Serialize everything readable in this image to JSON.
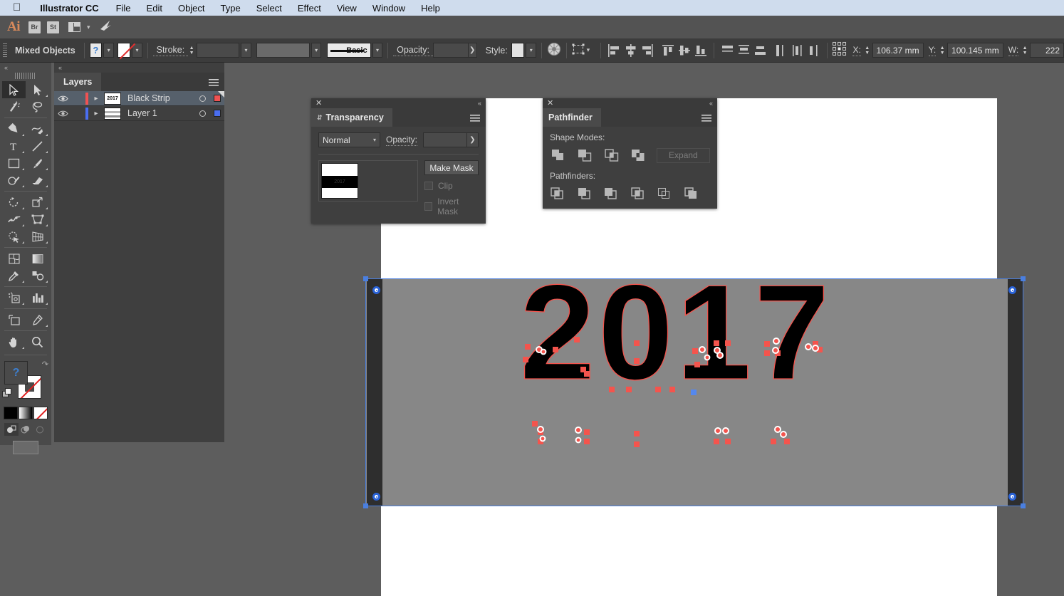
{
  "menubar": {
    "apple_glyph": "",
    "app_name": "Illustrator CC",
    "items": [
      "File",
      "Edit",
      "Object",
      "Type",
      "Select",
      "Effect",
      "View",
      "Window",
      "Help"
    ]
  },
  "appbar": {
    "logo": "Ai",
    "bridge_label": "Br",
    "stock_label": "St",
    "workspace_icon": "arrange-documents-icon",
    "behance_icon": "behance-icon"
  },
  "controlbar": {
    "selection_label": "Mixed Objects",
    "fill_swatch_value": "?",
    "stroke_swatch_value": "none",
    "stroke_label": "Stroke:",
    "stroke_weight": "",
    "stroke_profile": "",
    "brush_label": "Basic",
    "opacity_label": "Opacity:",
    "opacity_value": "",
    "style_label": "Style:",
    "recolor_icon": "recolor-artwork-icon",
    "transform_icon": "transform-panel-icon",
    "align_icons": [
      "align-left-icon",
      "align-horizontal-center-icon",
      "align-right-icon",
      "align-top-icon",
      "align-vertical-center-icon",
      "align-bottom-icon",
      "distribute-top-icon",
      "distribute-vertical-center-icon",
      "distribute-bottom-icon",
      "distribute-left-icon",
      "distribute-horizontal-center-icon",
      "distribute-right-icon"
    ],
    "reference_point_icon": "reference-point-icon",
    "x_label": "X:",
    "x_value": "106.37 mm",
    "y_label": "Y:",
    "y_value": "100.145 mm",
    "w_label": "W:",
    "w_value": "222"
  },
  "toolbar": {
    "collapse_glyph": "«",
    "tools": [
      {
        "name": "selection-tool",
        "active": true
      },
      {
        "name": "direct-selection-tool",
        "active": false
      },
      {
        "name": "magic-wand-tool",
        "active": false
      },
      {
        "name": "lasso-tool",
        "active": false
      },
      {
        "name": "pen-tool",
        "active": false
      },
      {
        "name": "curvature-tool",
        "active": false
      },
      {
        "name": "type-tool",
        "active": false
      },
      {
        "name": "line-segment-tool",
        "active": false
      },
      {
        "name": "rectangle-tool",
        "active": false
      },
      {
        "name": "paintbrush-tool",
        "active": false
      },
      {
        "name": "shaper-tool",
        "active": false
      },
      {
        "name": "eraser-tool",
        "active": false
      },
      {
        "name": "rotate-tool",
        "active": false
      },
      {
        "name": "scale-tool",
        "active": false
      },
      {
        "name": "width-tool",
        "active": false
      },
      {
        "name": "free-transform-tool",
        "active": false
      },
      {
        "name": "shape-builder-tool",
        "active": false
      },
      {
        "name": "perspective-grid-tool",
        "active": false
      },
      {
        "name": "mesh-tool",
        "active": false
      },
      {
        "name": "gradient-tool",
        "active": false
      },
      {
        "name": "eyedropper-tool",
        "active": false
      },
      {
        "name": "blend-tool",
        "active": false
      },
      {
        "name": "symbol-sprayer-tool",
        "active": false
      },
      {
        "name": "column-graph-tool",
        "active": false
      },
      {
        "name": "artboard-tool",
        "active": false
      },
      {
        "name": "slice-tool",
        "active": false
      },
      {
        "name": "hand-tool",
        "active": false
      },
      {
        "name": "zoom-tool",
        "active": false
      }
    ],
    "fill_value": "?",
    "stroke_value": "none",
    "color_buttons": [
      "color-button",
      "gradient-button",
      "none-button"
    ],
    "draw_modes": [
      "draw-normal-mode",
      "draw-behind-mode",
      "draw-inside-mode"
    ],
    "screen_mode": "change-screen-mode-button"
  },
  "layers_panel": {
    "collapse_glyph": "«",
    "tab_label": "Layers",
    "menu_icon": "panel-menu-icon",
    "layers": [
      {
        "name": "Black Strip",
        "thumb_text": "2017",
        "color": "#f05252",
        "selected": true,
        "visible": true,
        "thumb_kind": "art"
      },
      {
        "name": "Layer 1",
        "thumb_text": "",
        "color": "#4a6ef0",
        "selected": false,
        "visible": true,
        "thumb_kind": "stripes"
      }
    ]
  },
  "transparency_panel": {
    "close_glyph": "✕",
    "collapse_glyph": "«",
    "tab_label": "Transparency",
    "menu_icon": "panel-menu-icon",
    "blend_mode": "Normal",
    "opacity_label": "Opacity:",
    "opacity_value": "",
    "thumb_text": "2017",
    "make_mask_label": "Make Mask",
    "clip_label": "Clip",
    "invert_mask_label": "Invert Mask",
    "clip_checked": false,
    "invert_checked": false
  },
  "pathfinder_panel": {
    "close_glyph": "✕",
    "collapse_glyph": "«",
    "tab_label": "Pathfinder",
    "menu_icon": "panel-menu-icon",
    "shape_modes_label": "Shape Modes:",
    "shape_mode_icons": [
      "unite-icon",
      "minus-front-icon",
      "intersect-icon",
      "exclude-icon"
    ],
    "expand_label": "Expand",
    "expand_enabled": false,
    "pathfinders_label": "Pathfinders:",
    "pathfinder_icons": [
      "divide-icon",
      "trim-icon",
      "merge-icon",
      "crop-icon",
      "outline-icon",
      "minus-back-icon"
    ]
  },
  "canvas": {
    "artwork_text": "2017",
    "strip_color": "#878787",
    "black_strip_color": "#2e2e2e",
    "selection_color": "#4a7fe0",
    "path_color": "#f4544d",
    "background_color": "#5d5d5d",
    "artboard_color": "#ffffff"
  }
}
